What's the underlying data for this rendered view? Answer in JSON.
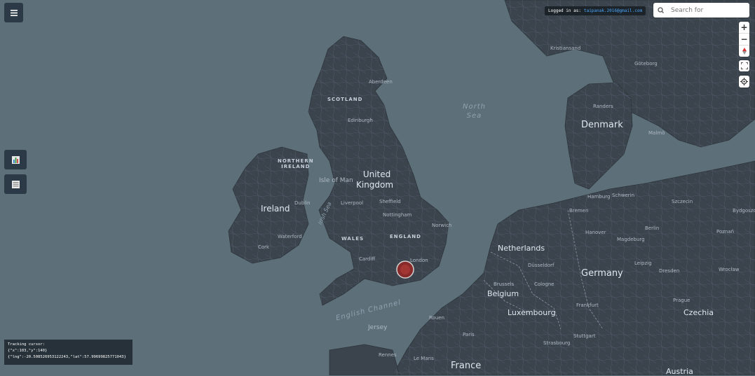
{
  "menu_icon": "hamburger-menu-icon",
  "login": {
    "prefix": "Logged in as:",
    "email": "taipanak.2016@gmail.com"
  },
  "search": {
    "placeholder": "Search for",
    "icon": "search-icon"
  },
  "zoom": {
    "in": "+",
    "out": "−"
  },
  "side_buttons": {
    "chart_icon": "chart-icon",
    "layers_icon": "layers-icon"
  },
  "tracker": {
    "title": "Tracking cursor:",
    "xy": "{\"x\":103,\"y\":140}",
    "lnglat": "{\"lng\":-20.508526953122243,\"lat\":57.99699825771043}"
  },
  "labels": {
    "united_kingdom_1": "United",
    "united_kingdom_2": "Kingdom",
    "ireland": "Ireland",
    "scotland": "SCOTLAND",
    "northern_ireland_1": "NORTHERN",
    "northern_ireland_2": "IRELAND",
    "wales": "WALES",
    "england": "ENGLAND",
    "isle_of_man": "Isle of Man",
    "north_sea_1": "North",
    "north_sea_2": "Sea",
    "irish_sea": "Irish Sea",
    "english_channel": "English Channel",
    "denmark": "Denmark",
    "netherlands": "Netherlands",
    "belgium": "Belgium",
    "luxembourg": "Luxembourg",
    "germany": "Germany",
    "france": "France",
    "czechia": "Czechia",
    "austria": "Austria",
    "jersey": "Jersey",
    "aberdeen": "Aberdeen",
    "edinburgh": "Edinburgh",
    "dublin": "Dublin",
    "cork": "Cork",
    "waterford": "Waterford",
    "liverpool": "Liverpool",
    "sheffield": "Sheffield",
    "nottingham": "Nottingham",
    "norwich": "Norwich",
    "cardiff": "Cardiff",
    "london": "London",
    "hamburg": "Hamburg",
    "bremen": "Bremen",
    "hanover": "Hanover",
    "berlin": "Berlin",
    "magdeburg": "Magdeburg",
    "dresden": "Dresden",
    "leipzig": "Leipzig",
    "dusseldorf": "Düsseldorf",
    "cologne": "Cologne",
    "frankfurt": "Frankfurt",
    "stuttgart": "Stuttgart",
    "strasbourg": "Strasbourg",
    "paris": "Paris",
    "rouen": "Rouen",
    "rennes": "Rennes",
    "le_mans": "Le Mans",
    "brussels": "Brussels",
    "schwerin": "Schwerin",
    "szczecin": "Szczecin",
    "poznan": "Poznań",
    "prague": "Prague",
    "wroclaw": "Wrocław",
    "bydgoszcz": "Bydgoszcz",
    "kristiansand": "Kristiansand",
    "goteborg": "Göteborg",
    "malmo": "Malmö",
    "randers": "Randers"
  },
  "colors": {
    "sea": "#5d6f79",
    "land": "#3a434b",
    "accent": "#4aa8ff",
    "marker": "#8a2b2b"
  }
}
